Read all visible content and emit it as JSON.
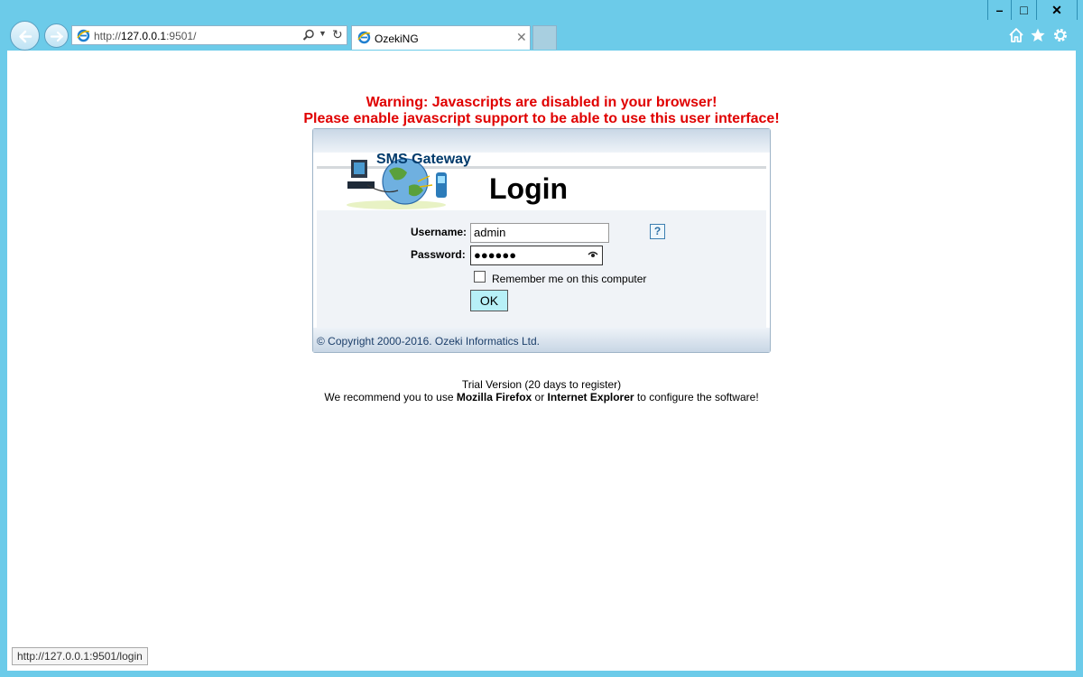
{
  "browser": {
    "url_prefix": "http://",
    "url_host": "127.0.0.1",
    "url_rest": ":9501/",
    "tab_title": "OzekiNG",
    "status_url": "http://127.0.0.1:9501/login",
    "window": {
      "minimize": "–",
      "maximize": "□",
      "close": "✕"
    }
  },
  "warning": {
    "line1": "Warning: Javascripts are disabled in your browser!",
    "line2": "Please enable javascript support to be able to use this user interface!"
  },
  "login": {
    "logo_text": "SMS Gateway",
    "title": "Login",
    "username_label": "Username:",
    "username_value": "admin",
    "password_label": "Password:",
    "password_value": "●●●●●●",
    "help": "?",
    "remember_label": "Remember me on this computer",
    "remember_checked": false,
    "ok_label": "OK",
    "copyright": "© Copyright 2000-2016. Ozeki Informatics Ltd."
  },
  "footer": {
    "trial": "Trial Version (20 days to register)",
    "rec_prefix": "We recommend you to use ",
    "firefox": "Mozilla Firefox",
    "or": " or ",
    "ie": "Internet Explorer",
    "rec_suffix": " to configure the software!"
  },
  "colors": {
    "warning": "#e00000",
    "chrome": "#6ccbe9",
    "ok_button": "#b7f0f7"
  }
}
